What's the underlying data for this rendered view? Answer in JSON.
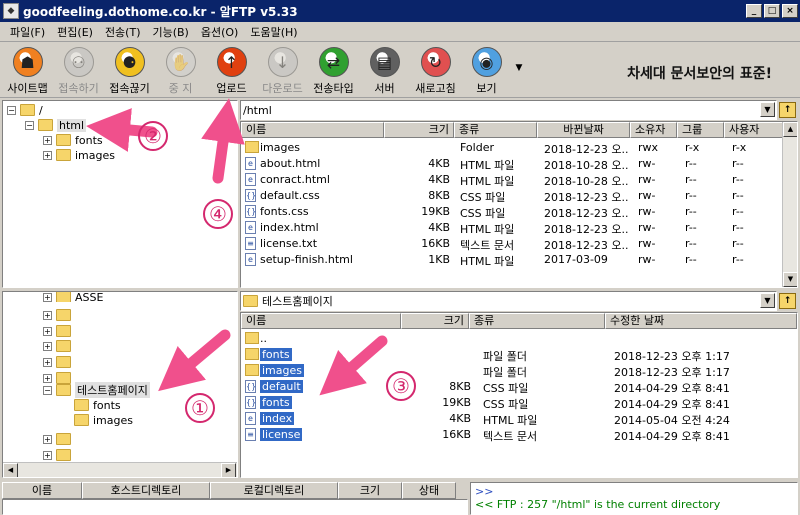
{
  "window": {
    "title": "goodfeeling.dothome.co.kr - 알FTP v5.33",
    "controls": [
      "_",
      "□",
      "×"
    ]
  },
  "menu": [
    "파일(F)",
    "편집(E)",
    "전송(T)",
    "기능(B)",
    "옵션(O)",
    "도움말(H)"
  ],
  "toolbar": {
    "buttons": [
      {
        "label": "사이트맵",
        "icon": "site-map-icon",
        "disabled": false,
        "color": "#f08020"
      },
      {
        "label": "접속하기",
        "icon": "connect-icon",
        "disabled": true,
        "color": "#c0c0c0"
      },
      {
        "label": "접속끊기",
        "icon": "disconnect-icon",
        "disabled": false,
        "color": "#f0c020"
      },
      {
        "label": "중 지",
        "icon": "stop-icon",
        "disabled": true,
        "color": "#d0d0d0"
      },
      {
        "label": "업로드",
        "icon": "upload-icon",
        "disabled": false,
        "color": "#e04010"
      },
      {
        "label": "다운로드",
        "icon": "download-icon",
        "disabled": true,
        "color": "#c0c0c0"
      },
      {
        "label": "전송타입",
        "icon": "transfer-type-icon",
        "disabled": false,
        "color": "#30a030"
      },
      {
        "label": "서버",
        "icon": "server-icon",
        "disabled": false,
        "color": "#606060"
      },
      {
        "label": "새로고침",
        "icon": "refresh-icon",
        "disabled": false,
        "color": "#e05050"
      },
      {
        "label": "보기",
        "icon": "view-icon",
        "disabled": false,
        "color": "#50a0e0"
      }
    ],
    "more_icon": "chevron-down-icon",
    "slogan": "차세대 문서보안의 표준!"
  },
  "remote": {
    "tree": {
      "root": "/",
      "selected": "html",
      "children": [
        "fonts",
        "images"
      ]
    },
    "path": "/html",
    "columns": [
      "이름",
      "크기",
      "종류",
      "바뀐날짜",
      "소유자",
      "그룹",
      "사용자"
    ],
    "files": [
      {
        "name": "images",
        "size": "",
        "type": "Folder",
        "date": "2018-12-23 오..",
        "owner": "rwx",
        "group": "r-x",
        "user": "r-x",
        "kind": "folder"
      },
      {
        "name": "about.html",
        "size": "4KB",
        "type": "HTML 파일",
        "date": "2018-10-28 오..",
        "owner": "rw-",
        "group": "r--",
        "user": "r--",
        "kind": "html"
      },
      {
        "name": "conract.html",
        "size": "4KB",
        "type": "HTML 파일",
        "date": "2018-10-28 오..",
        "owner": "rw-",
        "group": "r--",
        "user": "r--",
        "kind": "html"
      },
      {
        "name": "default.css",
        "size": "8KB",
        "type": "CSS 파일",
        "date": "2018-12-23 오..",
        "owner": "rw-",
        "group": "r--",
        "user": "r--",
        "kind": "css"
      },
      {
        "name": "fonts.css",
        "size": "19KB",
        "type": "CSS 파일",
        "date": "2018-12-23 오..",
        "owner": "rw-",
        "group": "r--",
        "user": "r--",
        "kind": "css"
      },
      {
        "name": "index.html",
        "size": "4KB",
        "type": "HTML 파일",
        "date": "2018-12-23 오..",
        "owner": "rw-",
        "group": "r--",
        "user": "r--",
        "kind": "html"
      },
      {
        "name": "license.txt",
        "size": "16KB",
        "type": "텍스트 문서",
        "date": "2018-12-23 오..",
        "owner": "rw-",
        "group": "r--",
        "user": "r--",
        "kind": "txt"
      },
      {
        "name": "setup-finish.html",
        "size": "1KB",
        "type": "HTML 파일",
        "date": "2017-03-09",
        "owner": "rw-",
        "group": "r--",
        "user": "r--",
        "kind": "html"
      }
    ]
  },
  "local": {
    "tree": {
      "partial": "ASSE",
      "selected": "테스트홈페이지",
      "children": [
        "fonts",
        "images"
      ]
    },
    "path": "테스트홈페이지",
    "columns": [
      "이름",
      "크기",
      "종류",
      "수정한 날짜"
    ],
    "files": [
      {
        "name": "..",
        "size": "",
        "type": "",
        "date": "",
        "kind": "folder",
        "selected": false
      },
      {
        "name": "fonts",
        "size": "",
        "type": "파일 폴더",
        "date": "2018-12-23 오후 1:17",
        "kind": "folder",
        "selected": true
      },
      {
        "name": "images",
        "size": "",
        "type": "파일 폴더",
        "date": "2018-12-23 오후 1:17",
        "kind": "folder",
        "selected": true
      },
      {
        "name": "default",
        "size": "8KB",
        "type": "CSS 파일",
        "date": "2014-04-29 오후 8:41",
        "kind": "css",
        "selected": true
      },
      {
        "name": "fonts",
        "size": "19KB",
        "type": "CSS 파일",
        "date": "2014-04-29 오후 8:41",
        "kind": "css",
        "selected": true
      },
      {
        "name": "index",
        "size": "4KB",
        "type": "HTML 파일",
        "date": "2014-05-04 오전 4:24",
        "kind": "html",
        "selected": true
      },
      {
        "name": "license",
        "size": "16KB",
        "type": "텍스트 문서",
        "date": "2014-04-29 오후 8:41",
        "kind": "txt",
        "selected": true
      }
    ]
  },
  "queue": {
    "columns": [
      "이름",
      "호스트디렉토리",
      "로컬디렉토리",
      "크기",
      "상태"
    ]
  },
  "log": {
    "lines": [
      ">>",
      "<< FTP : 257 \"/html\" is the current directory"
    ]
  },
  "annotations": {
    "color": "#f0508c",
    "badges": [
      "①",
      "②",
      "③",
      "④"
    ]
  }
}
